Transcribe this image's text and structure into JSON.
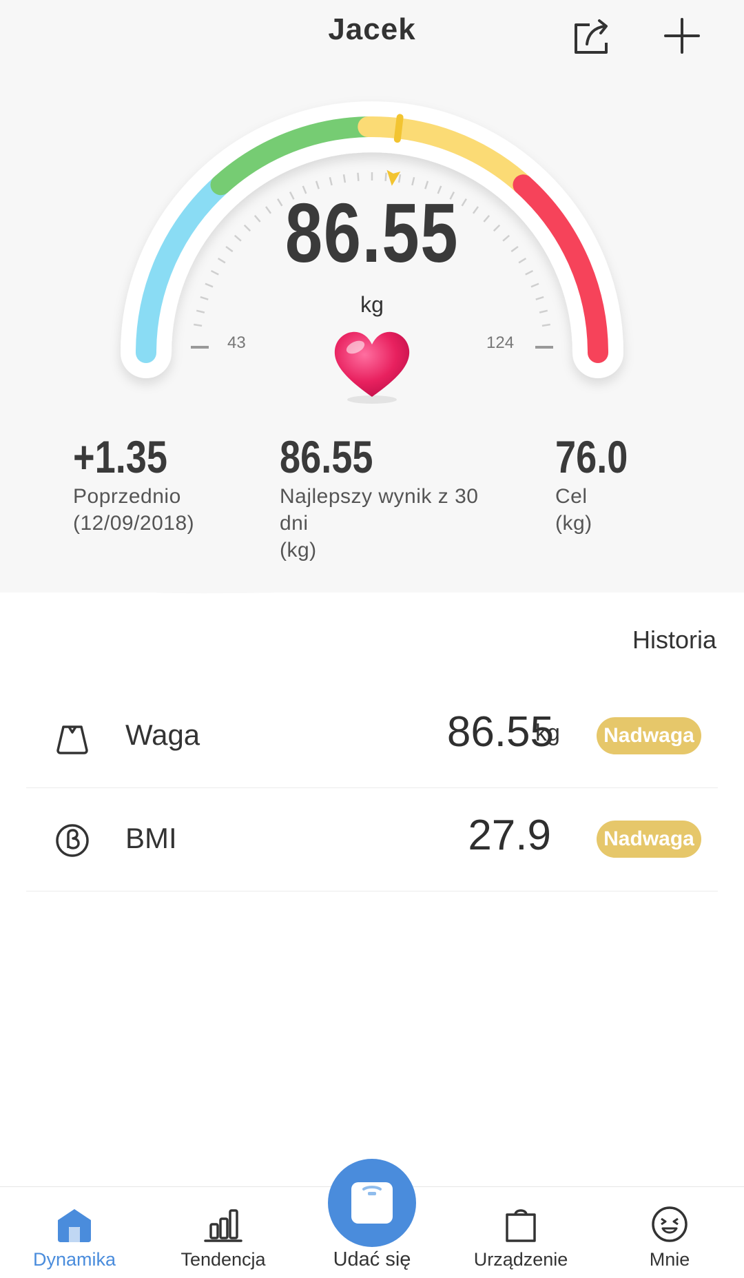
{
  "header": {
    "title": "Jacek",
    "share_icon": "share-icon",
    "add_icon": "plus-icon"
  },
  "gauge": {
    "value": "86.55",
    "unit": "kg",
    "min": "43",
    "max": "124",
    "value_numeric": 86.55,
    "min_numeric": 43,
    "max_numeric": 124,
    "zone_colors": [
      "#8adcf4",
      "#76cc73",
      "#fbdb75",
      "#f6435a"
    ],
    "indicator_icon": "arrow-indicator-icon",
    "status_icon": "heart-icon"
  },
  "stats": [
    {
      "value": "+1.35",
      "label_lines": [
        "Poprzednio",
        "(12/09/2018)"
      ]
    },
    {
      "value": "86.55",
      "label_lines": [
        "Najlepszy wynik z 30",
        "dni",
        "(kg)"
      ]
    },
    {
      "value": "76.0",
      "label_lines": [
        "Cel",
        "(kg)"
      ]
    }
  ],
  "history_link": "Historia",
  "metrics": [
    {
      "icon": "scale-bag-icon",
      "name": "Waga",
      "value": "86.55",
      "unit": "kg",
      "badge": "Nadwaga"
    },
    {
      "icon": "bmi-icon",
      "name": "BMI",
      "value": "27.9",
      "unit": "",
      "badge": "Nadwaga"
    }
  ],
  "badge_color": "#e6c76a",
  "accent_color": "#4a8cdc",
  "tabs": [
    {
      "label": "Dynamika",
      "icon": "home-icon",
      "active": true
    },
    {
      "label": "Tendencja",
      "icon": "bar-chart-icon",
      "active": false
    },
    {
      "label": "Udać się",
      "icon": "scale-icon",
      "active": false
    },
    {
      "label": "Urządzenie",
      "icon": "bag-icon",
      "active": false
    },
    {
      "label": "Mnie",
      "icon": "smiley-icon",
      "active": false
    }
  ]
}
